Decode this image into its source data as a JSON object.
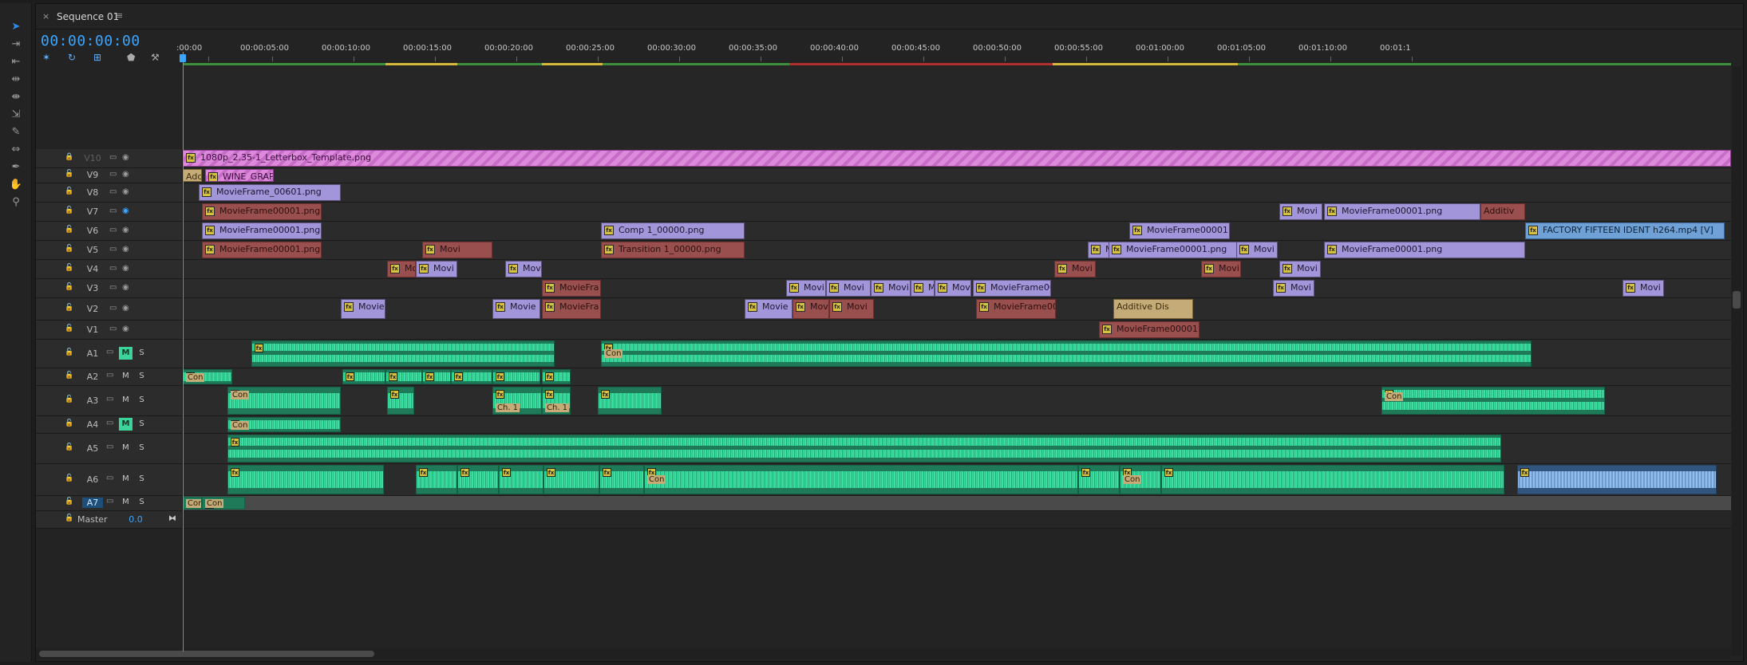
{
  "tab": {
    "close": "×",
    "title": "Sequence 01",
    "menu": "≡"
  },
  "timecode": "00:00:00:00",
  "header_icons": [
    "snap-icon",
    "linked-selection-icon",
    "add-marker-icon",
    "marker-icon",
    "wrench-icon"
  ],
  "tools": [
    "selection-tool-icon",
    "track-select-tool-icon",
    "ripple-edit-tool-icon",
    "rolling-edit-tool-icon",
    "rate-stretch-tool-icon",
    "razor-tool-icon",
    "slip-tool-icon",
    "slide-tool-icon",
    "pen-tool-icon",
    "hand-tool-icon",
    "zoom-tool-icon"
  ],
  "ruler": {
    "ticks": [
      ":00:00",
      "00:00:05:00",
      "00:00:10:00",
      "00:00:15:00",
      "00:00:20:00",
      "00:00:25:00",
      "00:00:30:00",
      "00:00:35:00",
      "00:00:40:00",
      "00:00:45:00",
      "00:00:50:00",
      "00:00:55:00",
      "00:01:00:00",
      "00:01:05:00",
      "00:01:10:00",
      "00:01:1"
    ]
  },
  "tracks": {
    "video": [
      {
        "name": "V10",
        "locked": true
      },
      {
        "name": "V9"
      },
      {
        "name": "V8"
      },
      {
        "name": "V7"
      },
      {
        "name": "V6"
      },
      {
        "name": "V5"
      },
      {
        "name": "V4"
      },
      {
        "name": "V3"
      },
      {
        "name": "V2"
      },
      {
        "name": "V1"
      }
    ],
    "audio": [
      {
        "name": "A1",
        "m": "M",
        "s": "S",
        "muted": true
      },
      {
        "name": "A2",
        "m": "M",
        "s": "S"
      },
      {
        "name": "A3",
        "m": "M",
        "s": "S"
      },
      {
        "name": "A4",
        "m": "M",
        "s": "S",
        "muted": true
      },
      {
        "name": "A5",
        "m": "M",
        "s": "S"
      },
      {
        "name": "A6",
        "m": "M",
        "s": "S"
      },
      {
        "name": "A7",
        "m": "M",
        "s": "S",
        "selected": true
      }
    ],
    "master": {
      "name": "Master",
      "value": "0.0"
    }
  },
  "clips": {
    "v10": [
      {
        "label": "1080p_2.35-1_Letterbox_Template.png"
      }
    ],
    "v9": [
      {
        "label": "Add"
      },
      {
        "label": "WINE_GRAP"
      }
    ],
    "v8": [
      {
        "label": "MovieFrame_00601.png"
      }
    ],
    "v7": [
      {
        "label": "MovieFrame00001.png"
      },
      {
        "label": "Movi"
      },
      {
        "label": "MovieFrame00001.png"
      },
      {
        "label": "Additiv"
      }
    ],
    "v6": [
      {
        "label": "MovieFrame00001.png"
      },
      {
        "label": "Comp 1_00000.png"
      },
      {
        "label": "MovieFrame00001.png"
      },
      {
        "label": "FACTORY FIFTEEN IDENT h264.mp4 [V]"
      }
    ],
    "v5": [
      {
        "label": "MovieFrame00001.png"
      },
      {
        "label": "Movi"
      },
      {
        "label": "Transition 1_00000.png"
      },
      {
        "label": "Movi"
      },
      {
        "label": "MovieFrame00001.png"
      },
      {
        "label": "Movi"
      },
      {
        "label": "MovieFrame00001.png"
      }
    ],
    "v4": [
      {
        "label": "Movi"
      },
      {
        "label": "Movi"
      },
      {
        "label": "Movi"
      },
      {
        "label": "Movi"
      }
    ],
    "v3": [
      {
        "label": "MovieFra"
      },
      {
        "label": "Movi"
      },
      {
        "label": "Movi"
      },
      {
        "label": "Movi"
      },
      {
        "label": "Mo"
      },
      {
        "label": "MovieFrame00"
      },
      {
        "label": "Movi"
      },
      {
        "label": "Movi"
      }
    ],
    "v2": [
      {
        "label": "Movie"
      },
      {
        "label": "Movie"
      },
      {
        "label": "MovieFra"
      },
      {
        "label": "Movie"
      },
      {
        "label": "Movi"
      },
      {
        "label": "Movi"
      },
      {
        "label": "MovieFrame00"
      },
      {
        "label": "Additive Dis"
      }
    ],
    "v1": [
      {
        "label": "MovieFrame00001.png"
      }
    ],
    "audio_labels": {
      "con": "Con",
      "ch": "Ch. 1"
    }
  }
}
